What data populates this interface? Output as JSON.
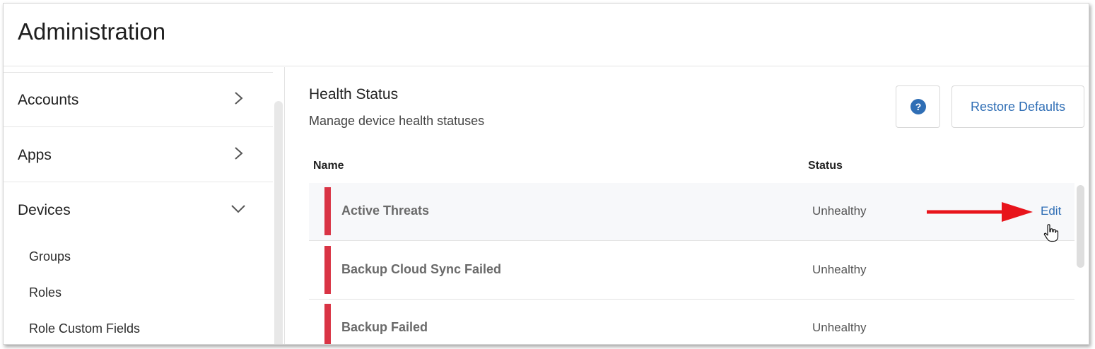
{
  "header": {
    "title": "Administration"
  },
  "sidebar": {
    "items": [
      {
        "label": "Accounts",
        "icon": "chevron-right-icon"
      },
      {
        "label": "Apps",
        "icon": "chevron-right-icon"
      },
      {
        "label": "Devices",
        "icon": "chevron-down-icon"
      }
    ],
    "subitems": [
      {
        "label": "Groups"
      },
      {
        "label": "Roles"
      },
      {
        "label": "Role Custom Fields"
      }
    ]
  },
  "main": {
    "title": "Health Status",
    "subtitle": "Manage device health statuses",
    "help_icon": "question-circle-icon",
    "help_glyph": "?",
    "restore_label": "Restore Defaults",
    "columns": {
      "name": "Name",
      "status": "Status"
    },
    "rows": [
      {
        "name": "Active Threats",
        "status": "Unhealthy",
        "action": "Edit",
        "indicator_color": "#d93445"
      },
      {
        "name": "Backup Cloud Sync Failed",
        "status": "Unhealthy",
        "indicator_color": "#d93445"
      },
      {
        "name": "Backup Failed",
        "status": "Unhealthy",
        "indicator_color": "#d93445"
      }
    ]
  },
  "annotations": {
    "arrow_color": "#e8141b",
    "arrow_icon": "red-arrow-icon",
    "cursor_icon": "hand-pointer-icon"
  },
  "colors": {
    "accent": "#2f6eb5",
    "danger": "#d93445"
  }
}
